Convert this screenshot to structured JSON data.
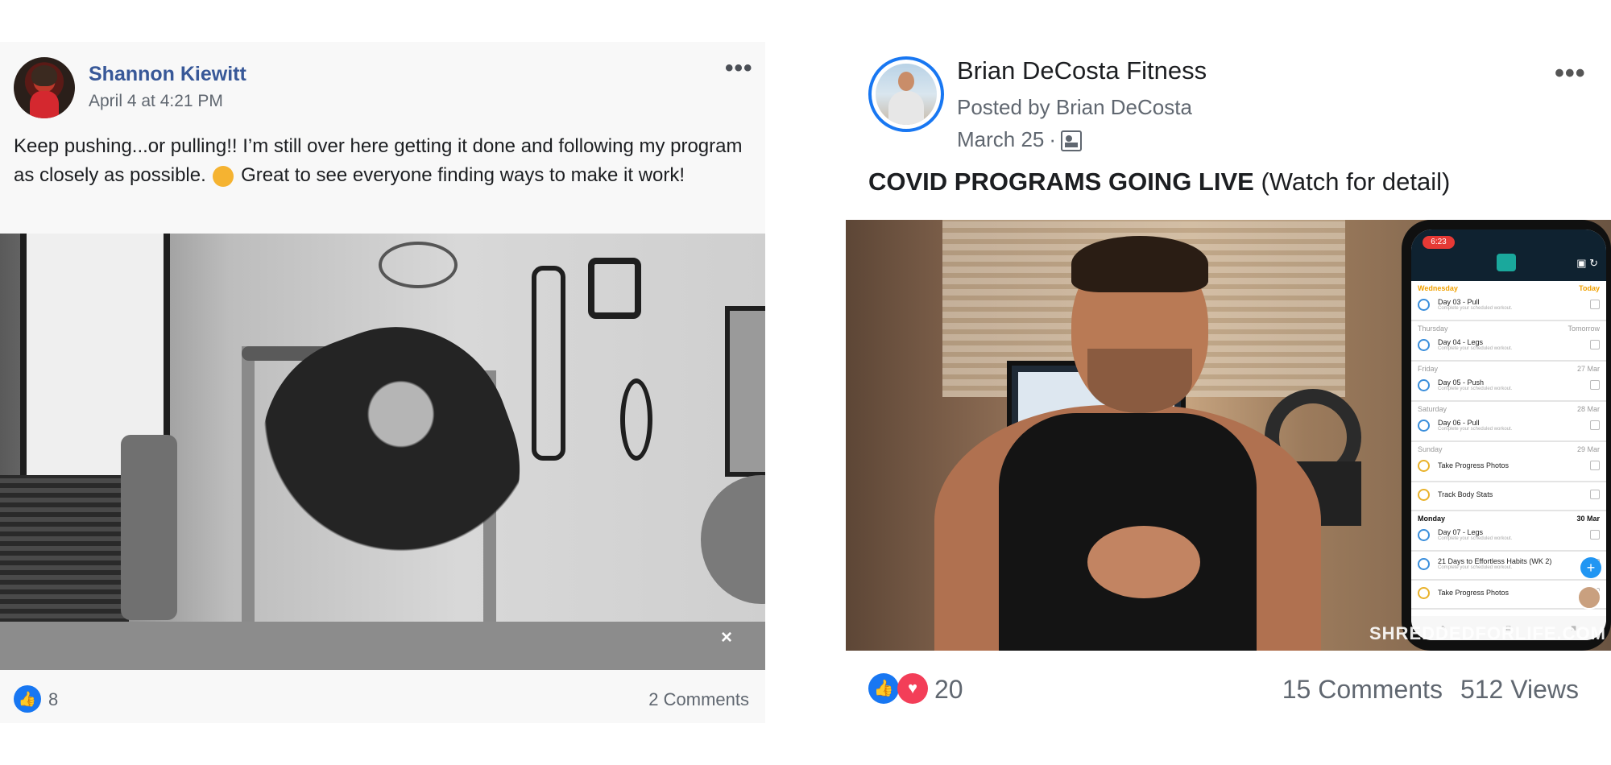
{
  "left_post": {
    "author": "Shannon Kiewitt",
    "timestamp": "April 4 at 4:21 PM",
    "menu": "•••",
    "text_before_emoji": "Keep pushing...or pulling!! I’m still over here getting it done and following my program as closely as possible. ",
    "emoji_icon": "flexed-biceps",
    "text_after_emoji": " Great to see everyone finding ways to make it work!",
    "media": {
      "type": "video",
      "mute_symbol": "×"
    },
    "reactions": {
      "icon": "like",
      "count": "8"
    },
    "comments": "2 Comments"
  },
  "right_post": {
    "author": "Brian DeCosta Fitness",
    "posted_by": "Posted by Brian DeCosta",
    "date": "March 25",
    "separator": "·",
    "menu": "•••",
    "headline_bold": "COVID PROGRAMS GOING LIVE",
    "headline_rest": " (Watch for detail)",
    "media": {
      "type": "video",
      "watermark": "SHREDDEDFORLIFE.COM",
      "phone": {
        "time": "6:23",
        "fab": "+",
        "schedule": [
          {
            "day": "Wednesday",
            "when": "Today",
            "items": [
              {
                "title": "Day 03 - Pull",
                "sub": "Complete your scheduled workout.",
                "ring": "blue"
              }
            ]
          },
          {
            "day": "Thursday",
            "when": "Tomorrow",
            "items": [
              {
                "title": "Day 04 - Legs",
                "sub": "Complete your scheduled workout.",
                "ring": "blue"
              }
            ]
          },
          {
            "day": "Friday",
            "when": "27 Mar",
            "items": [
              {
                "title": "Day 05 - Push",
                "sub": "Complete your scheduled workout.",
                "ring": "blue"
              }
            ]
          },
          {
            "day": "Saturday",
            "when": "28 Mar",
            "items": [
              {
                "title": "Day 06 - Pull",
                "sub": "Complete your scheduled workout.",
                "ring": "blue"
              }
            ]
          },
          {
            "day": "Sunday",
            "when": "29 Mar",
            "items": [
              {
                "title": "Take Progress Photos",
                "sub": "",
                "ring": "yellow"
              },
              {
                "title": "Track Body Stats",
                "sub": "",
                "ring": "yellow"
              }
            ]
          },
          {
            "day": "Monday",
            "when": "30 Mar",
            "items": [
              {
                "title": "Day 07 - Legs",
                "sub": "Complete your scheduled workout.",
                "ring": "blue"
              },
              {
                "title": "21 Days to Effortless Habits (WK 2)",
                "sub": "Complete your scheduled workout.",
                "ring": "blue"
              },
              {
                "title": "Take Progress Photos",
                "sub": "",
                "ring": "yellow"
              }
            ]
          }
        ]
      }
    },
    "reactions": {
      "icons": [
        "like",
        "love"
      ],
      "count": "20"
    },
    "comments": "15 Comments",
    "views": "512 Views"
  },
  "colors": {
    "link_blue": "#385898",
    "facebook_blue": "#1877f2",
    "love_red": "#f33e58",
    "meta_gray": "#606770"
  }
}
